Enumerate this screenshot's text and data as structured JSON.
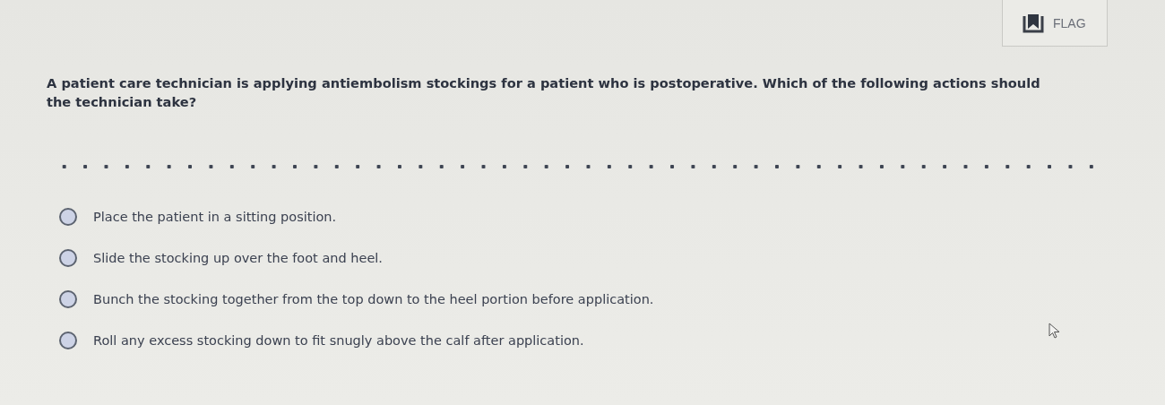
{
  "flag_button": {
    "label": "FLAG"
  },
  "question": "A patient care technician is applying antiembolism stockings for a patient who is postoperative. Which of the following actions should the technician take?",
  "options": [
    {
      "label": "Place the patient in a sitting position.",
      "selected": false
    },
    {
      "label": "Slide the stocking up over the foot and heel.",
      "selected": false
    },
    {
      "label": "Bunch the stocking together from the top down to the heel portion before application.",
      "selected": false
    },
    {
      "label": "Roll any excess stocking down to fit snugly above the calf after application.",
      "selected": false
    }
  ]
}
